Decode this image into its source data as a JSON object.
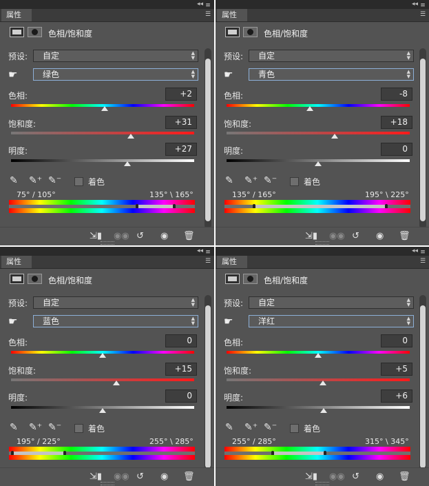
{
  "panels": [
    {
      "tab": "属性",
      "title": "色相/饱和度",
      "preset_label": "预设:",
      "preset_value": "自定",
      "channel": "绿色",
      "hue_label": "色相:",
      "hue": "+2",
      "hue_level": 0.51,
      "sat_label": "饱和度:",
      "sat": "+31",
      "sat_level": 0.655,
      "light_label": "明度:",
      "light": "+27",
      "light_level": 0.635,
      "colorize_label": "着色",
      "range_left": "75° / 105°",
      "range_right": "135° \\ 165°"
    },
    {
      "tab": "属性",
      "title": "色相/饱和度",
      "preset_label": "预设:",
      "preset_value": "自定",
      "channel": "青色",
      "hue_label": "色相:",
      "hue": "-8",
      "hue_level": 0.455,
      "sat_label": "饱和度:",
      "sat": "+18",
      "sat_level": 0.59,
      "light_label": "明度:",
      "light": "0",
      "light_level": 0.5,
      "colorize_label": "着色",
      "range_left": "135° / 165°",
      "range_right": "195° \\ 225°"
    },
    {
      "tab": "属性",
      "title": "色相/饱和度",
      "preset_label": "预设:",
      "preset_value": "自定",
      "channel": "蓝色",
      "hue_label": "色相:",
      "hue": "0",
      "hue_level": 0.5,
      "sat_label": "饱和度:",
      "sat": "+15",
      "sat_level": 0.575,
      "light_label": "明度:",
      "light": "0",
      "light_level": 0.5,
      "colorize_label": "着色",
      "range_left": "195° / 225°",
      "range_right": "255° \\ 285°"
    },
    {
      "tab": "属性",
      "title": "色相/饱和度",
      "preset_label": "预设:",
      "preset_value": "自定",
      "channel": "洋红",
      "hue_label": "色相:",
      "hue": "0",
      "hue_level": 0.5,
      "sat_label": "饱和度:",
      "sat": "+5",
      "sat_level": 0.525,
      "light_label": "明度:",
      "light": "+6",
      "light_level": 0.53,
      "colorize_label": "着色",
      "range_left": "255° / 285°",
      "range_right": "315° \\ 345°"
    }
  ],
  "icons": {
    "menu": "panel-menu-icon",
    "collapse": "double-arrow-icon",
    "adjustment": "adjustment-layer-icon",
    "mask": "mask-icon",
    "hand": "targeted-adjustment-hand-icon",
    "eyedropper": "eyedropper-icon",
    "eyedropper_plus": "add-to-sample-icon",
    "eyedropper_minus": "subtract-from-sample-icon",
    "clip": "clip-to-layer-icon",
    "view_previous": "view-previous-state-icon",
    "reset": "reset-icon",
    "visibility": "eye-icon",
    "delete": "trash-icon"
  },
  "colors": {
    "panel_bg": "#535353",
    "tab_bar": "#3b3b3b",
    "field_bg": "#3e3e3e",
    "focus_border": "#8db0d8"
  }
}
